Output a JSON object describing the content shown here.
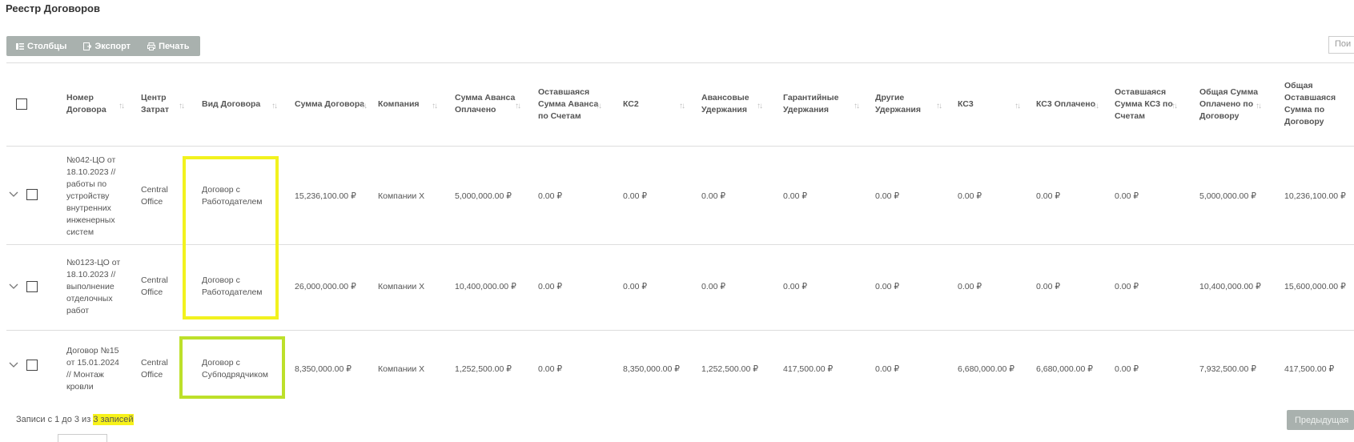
{
  "page": {
    "title": "Реестр Договоров"
  },
  "toolbar": {
    "columns_label": "Столбцы",
    "export_label": "Экспорт",
    "print_label": "Печать"
  },
  "search": {
    "placeholder": "Пои"
  },
  "icons": {
    "columns": "columns-icon",
    "export": "export-icon",
    "print": "print-icon",
    "sort": "sort-icon",
    "expand": "chevron-down-icon"
  },
  "colors": {
    "toolbar_bg": "#a9b1ae",
    "highlight_yellow": "#f2f21e",
    "highlight_green": "#bde02a",
    "footer_mark": "#f7f21a"
  },
  "table": {
    "headers": [
      "Номер Договора",
      "Центр Затрат",
      "Вид Договора",
      "Сумма Договора",
      "Компания",
      "Сумма Аванса Оплачено",
      "Оставшаяся Сумма Аванса по Счетам",
      "КС2",
      "Авансовые Удержания",
      "Гарантийные Удержания",
      "Другие Удержания",
      "КС3",
      "КС3 Оплачено",
      "Оставшаяся Сумма КС3 по Счетам",
      "Общая Сумма Оплачено по Договору",
      "Общая Оставшаяся Сумма по Договору"
    ],
    "rows": [
      {
        "cells": [
          "№042-ЦО от 18.10.2023 // работы по устройству внутренних инженерных систем",
          "Central Office",
          "Договор с Работодателем",
          "15,236,100.00 ₽",
          "Компании X",
          "5,000,000.00 ₽",
          "0.00 ₽",
          "0.00 ₽",
          "0.00 ₽",
          "0.00 ₽",
          "0.00 ₽",
          "0.00 ₽",
          "0.00 ₽",
          "0.00 ₽",
          "5,000,000.00 ₽",
          "10,236,100.00 ₽"
        ]
      },
      {
        "cells": [
          "№0123-ЦО от 18.10.2023 // выполнение отделочных работ",
          "Central Office",
          "Договор с Работодателем",
          "26,000,000.00 ₽",
          "Компании X",
          "10,400,000.00 ₽",
          "0.00 ₽",
          "0.00 ₽",
          "0.00 ₽",
          "0.00 ₽",
          "0.00 ₽",
          "0.00 ₽",
          "0.00 ₽",
          "0.00 ₽",
          "10,400,000.00 ₽",
          "15,600,000.00 ₽"
        ]
      },
      {
        "cells": [
          "Договор №15 от 15.01.2024 // Монтаж кровли",
          "Central Office",
          "Договор с Субподрядчиком",
          "8,350,000.00 ₽",
          "Компании X",
          "1,252,500.00 ₽",
          "0.00 ₽",
          "8,350,000.00 ₽",
          "1,252,500.00 ₽",
          "417,500.00 ₽",
          "0.00 ₽",
          "6,680,000.00 ₽",
          "6,680,000.00 ₽",
          "0.00 ₽",
          "7,932,500.00 ₽",
          "417,500.00 ₽"
        ]
      }
    ]
  },
  "footer": {
    "info_prefix": "Записи с 1 до 3 из ",
    "info_total": "3 записей",
    "prev_label": "Предыдущая"
  }
}
